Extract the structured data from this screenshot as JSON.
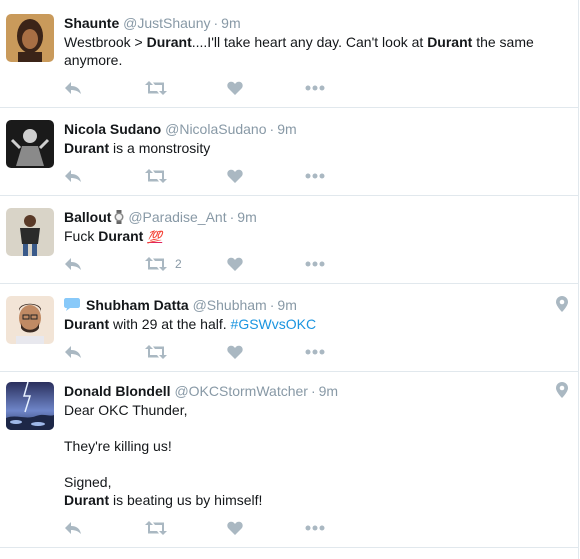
{
  "tweets": [
    {
      "name": "Shaunte",
      "handle": "@JustShauny",
      "time": "9m",
      "text_parts": [
        "Westbrook > ",
        "Durant",
        "....I'll take heart any day. Can't look at ",
        "Durant",
        " the same anymore."
      ],
      "retweet_count": "",
      "avatar_colors": [
        "#c99a5b",
        "#3b2418"
      ]
    },
    {
      "name": "Nicola Sudano",
      "handle": "@NicolaSudano",
      "time": "9m",
      "text_parts": [
        "Durant",
        " is a monstrosity"
      ],
      "retweet_count": "",
      "avatar_colors": [
        "#1a1a1a",
        "#cfcfcf"
      ]
    },
    {
      "name": "Ballout",
      "handle": "@Paradise_Ant",
      "time": "9m",
      "text_parts": [
        "Fuck ",
        "Durant",
        "💯"
      ],
      "retweet_count": "2",
      "avatar_colors": [
        "#d9d4c8",
        "#2b2b2b"
      ]
    },
    {
      "name": "Shubham Datta",
      "handle": "@Shubham",
      "time": "9m",
      "text_parts": [
        "Durant",
        " with 29 at the half. ",
        "#GSWvsOKC"
      ],
      "retweet_count": "",
      "avatar_colors": [
        "#f2e4d6",
        "#3a2a22"
      ]
    },
    {
      "name": "Donald Blondell",
      "handle": "@OKCStormWatcher",
      "time": "9m",
      "lines": [
        "Dear OKC Thunder,",
        "",
        "They're killing us!",
        "",
        "Signed,",
        "Durant",
        " is beating us by himself!"
      ],
      "retweet_count": "",
      "avatar_colors": [
        "#3b4a7a",
        "#a9c4f0"
      ]
    }
  ],
  "colors": {
    "action_icon": "#aab8c2",
    "meta_text": "#8899a6",
    "link": "#1b95e0",
    "divider": "#e1e8ed",
    "emoji_100": "#e0245e"
  },
  "icons": {
    "reply": "reply-icon",
    "retweet": "retweet-icon",
    "like": "heart-icon",
    "more": "more-icon",
    "location": "location-pin-icon",
    "watch": "watch-icon",
    "speech": "speech-bubble-icon"
  }
}
